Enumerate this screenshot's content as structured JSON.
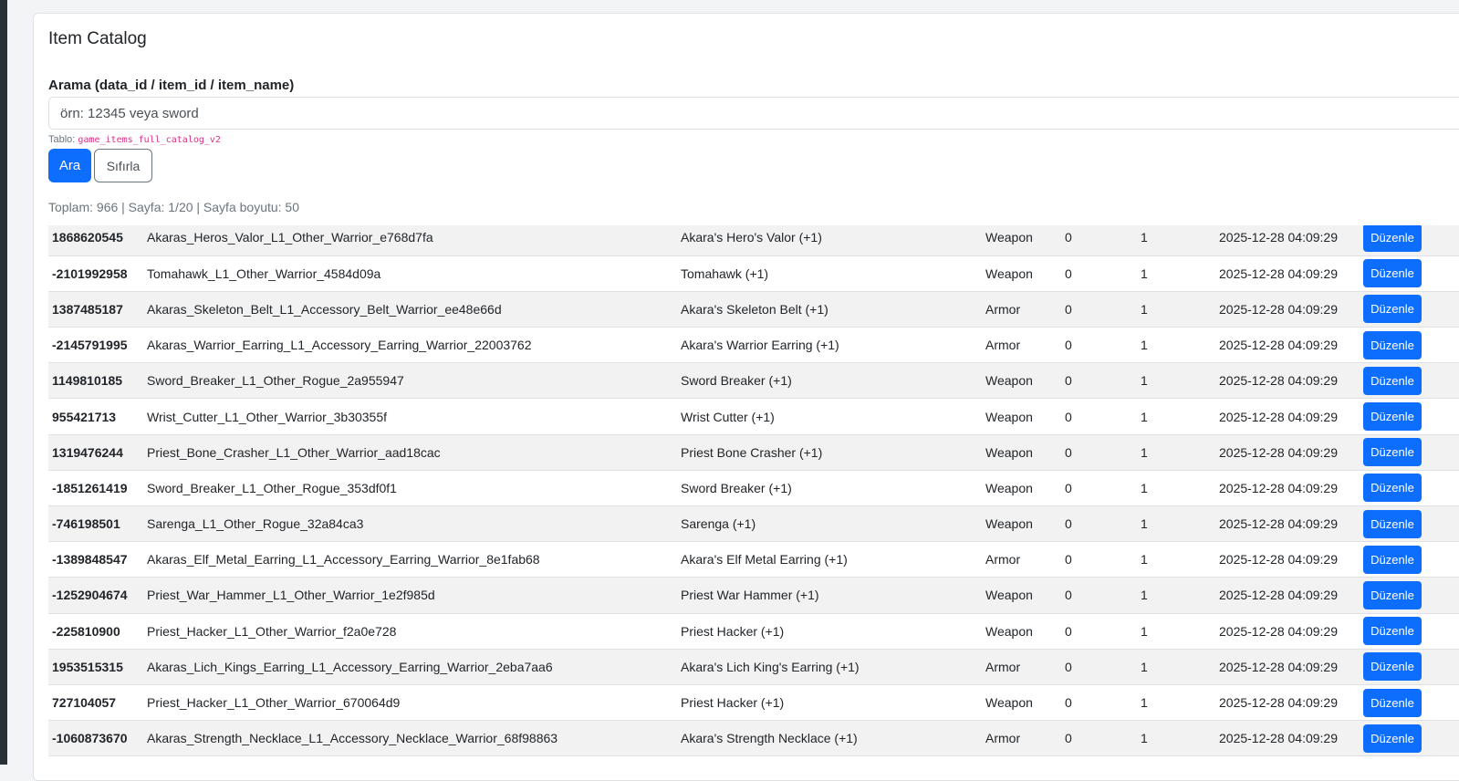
{
  "page": {
    "title": "Item Catalog",
    "search": {
      "label": "Arama (data_id / item_id / item_name)",
      "placeholder": "örn: 12345 veya sword",
      "value": ""
    },
    "table_hint": {
      "prefix": "Tablo:",
      "name": "game_items_full_catalog_v2"
    },
    "buttons": {
      "search": "Ara",
      "reset": "Sıfırla",
      "edit": "Düzenle"
    },
    "stats": "Toplam: 966 | Sayfa: 1/20 | Sayfa boyutu: 50",
    "colors": {
      "primary": "#0d6efd",
      "stripe": "#f2f2f2",
      "code": "#d63384"
    }
  },
  "rows": [
    {
      "id": "1868620545",
      "key": "Akaras_Heros_Valor_L1_Other_Warrior_e768d7fa",
      "name": "Akara's Hero's Valor (+1)",
      "type": "Weapon",
      "v1": "0",
      "v2": "1",
      "date": "2025-12-28 04:09:29"
    },
    {
      "id": "-2101992958",
      "key": "Tomahawk_L1_Other_Warrior_4584d09a",
      "name": "Tomahawk (+1)",
      "type": "Weapon",
      "v1": "0",
      "v2": "1",
      "date": "2025-12-28 04:09:29"
    },
    {
      "id": "1387485187",
      "key": "Akaras_Skeleton_Belt_L1_Accessory_Belt_Warrior_ee48e66d",
      "name": "Akara's Skeleton Belt (+1)",
      "type": "Armor",
      "v1": "0",
      "v2": "1",
      "date": "2025-12-28 04:09:29"
    },
    {
      "id": "-2145791995",
      "key": "Akaras_Warrior_Earring_L1_Accessory_Earring_Warrior_22003762",
      "name": "Akara's Warrior Earring (+1)",
      "type": "Armor",
      "v1": "0",
      "v2": "1",
      "date": "2025-12-28 04:09:29"
    },
    {
      "id": "1149810185",
      "key": "Sword_Breaker_L1_Other_Rogue_2a955947",
      "name": "Sword Breaker (+1)",
      "type": "Weapon",
      "v1": "0",
      "v2": "1",
      "date": "2025-12-28 04:09:29"
    },
    {
      "id": "955421713",
      "key": "Wrist_Cutter_L1_Other_Warrior_3b30355f",
      "name": "Wrist Cutter (+1)",
      "type": "Weapon",
      "v1": "0",
      "v2": "1",
      "date": "2025-12-28 04:09:29"
    },
    {
      "id": "1319476244",
      "key": "Priest_Bone_Crasher_L1_Other_Warrior_aad18cac",
      "name": "Priest Bone Crasher (+1)",
      "type": "Weapon",
      "v1": "0",
      "v2": "1",
      "date": "2025-12-28 04:09:29"
    },
    {
      "id": "-1851261419",
      "key": "Sword_Breaker_L1_Other_Rogue_353df0f1",
      "name": "Sword Breaker (+1)",
      "type": "Weapon",
      "v1": "0",
      "v2": "1",
      "date": "2025-12-28 04:09:29"
    },
    {
      "id": "-746198501",
      "key": "Sarenga_L1_Other_Rogue_32a84ca3",
      "name": "Sarenga (+1)",
      "type": "Weapon",
      "v1": "0",
      "v2": "1",
      "date": "2025-12-28 04:09:29"
    },
    {
      "id": "-1389848547",
      "key": "Akaras_Elf_Metal_Earring_L1_Accessory_Earring_Warrior_8e1fab68",
      "name": "Akara's Elf Metal Earring (+1)",
      "type": "Armor",
      "v1": "0",
      "v2": "1",
      "date": "2025-12-28 04:09:29"
    },
    {
      "id": "-1252904674",
      "key": "Priest_War_Hammer_L1_Other_Warrior_1e2f985d",
      "name": "Priest War Hammer (+1)",
      "type": "Weapon",
      "v1": "0",
      "v2": "1",
      "date": "2025-12-28 04:09:29"
    },
    {
      "id": "-225810900",
      "key": "Priest_Hacker_L1_Other_Warrior_f2a0e728",
      "name": "Priest Hacker (+1)",
      "type": "Weapon",
      "v1": "0",
      "v2": "1",
      "date": "2025-12-28 04:09:29"
    },
    {
      "id": "1953515315",
      "key": "Akaras_Lich_Kings_Earring_L1_Accessory_Earring_Warrior_2eba7aa6",
      "name": "Akara's Lich King's Earring (+1)",
      "type": "Armor",
      "v1": "0",
      "v2": "1",
      "date": "2025-12-28 04:09:29"
    },
    {
      "id": "727104057",
      "key": "Priest_Hacker_L1_Other_Warrior_670064d9",
      "name": "Priest Hacker (+1)",
      "type": "Weapon",
      "v1": "0",
      "v2": "1",
      "date": "2025-12-28 04:09:29"
    },
    {
      "id": "-1060873670",
      "key": "Akaras_Strength_Necklace_L1_Accessory_Necklace_Warrior_68f98863",
      "name": "Akara's Strength Necklace (+1)",
      "type": "Armor",
      "v1": "0",
      "v2": "1",
      "date": "2025-12-28 04:09:29"
    }
  ]
}
